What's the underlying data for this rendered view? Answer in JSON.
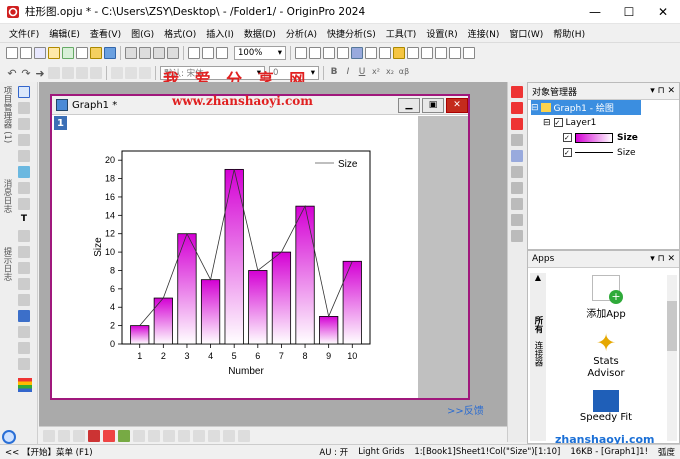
{
  "window": {
    "title": "柱形图.opju * - C:\\Users\\ZSY\\Desktop\\ - /Folder1/ - OriginPro 2024",
    "min": "—",
    "max": "☐",
    "close": "✕"
  },
  "menu": [
    "文件(F)",
    "编辑(E)",
    "查看(V)",
    "图(G)",
    "格式(O)",
    "插入(I)",
    "数据(D)",
    "分析(A)",
    "快捷分析(S)",
    "工具(T)",
    "设置(R)",
    "连接(N)",
    "窗口(W)",
    "帮助(H)"
  ],
  "toolbar": {
    "zoom": "100%",
    "font_placeholder": "默认: 宋体",
    "font_size": "0"
  },
  "watermarks": {
    "cn": "我 爱 分 享 网",
    "url": "www.zhanshaoyi.com",
    "corner": "zhanshaoyi.com"
  },
  "left_tabs": [
    "项目管理器 (1)",
    "消息日志",
    "提示日志"
  ],
  "graph": {
    "title": "Graph1 *",
    "layer_badge": "1"
  },
  "chart_data": {
    "type": "bar",
    "categories": [
      1,
      2,
      3,
      4,
      5,
      6,
      7,
      8,
      9,
      10
    ],
    "values": [
      2,
      5,
      12,
      7,
      19,
      8,
      10,
      15,
      3,
      9
    ],
    "xlabel": "Number",
    "ylabel": "Size",
    "ylim": [
      0,
      21
    ],
    "yticks": [
      0,
      2,
      4,
      6,
      8,
      10,
      12,
      14,
      16,
      18,
      20
    ],
    "legend": {
      "label": "Size",
      "placement": "top-right"
    },
    "overlay_line": true,
    "bar_gradient": [
      "#d400d4",
      "#ffffff"
    ]
  },
  "object_manager": {
    "title": "对象管理器",
    "root": "Graph1 - 绘图",
    "layer": "Layer1",
    "items": [
      "Size",
      "Size"
    ]
  },
  "apps": {
    "title": "Apps",
    "tabs": [
      "所有",
      "连接器"
    ],
    "items": [
      "添加App",
      "Stats Advisor",
      "Speedy Fit"
    ]
  },
  "statusbar": {
    "start": "<<  【开始】菜单 (F1)",
    "au": "AU : 开",
    "grids": "Light Grids",
    "cell": "1:[Book1]Sheet1!Col(\"Size\")[1:10]",
    "size": "16KB - [Graph1]1!",
    "angle": "弧度"
  },
  "relink": ">>反馈"
}
